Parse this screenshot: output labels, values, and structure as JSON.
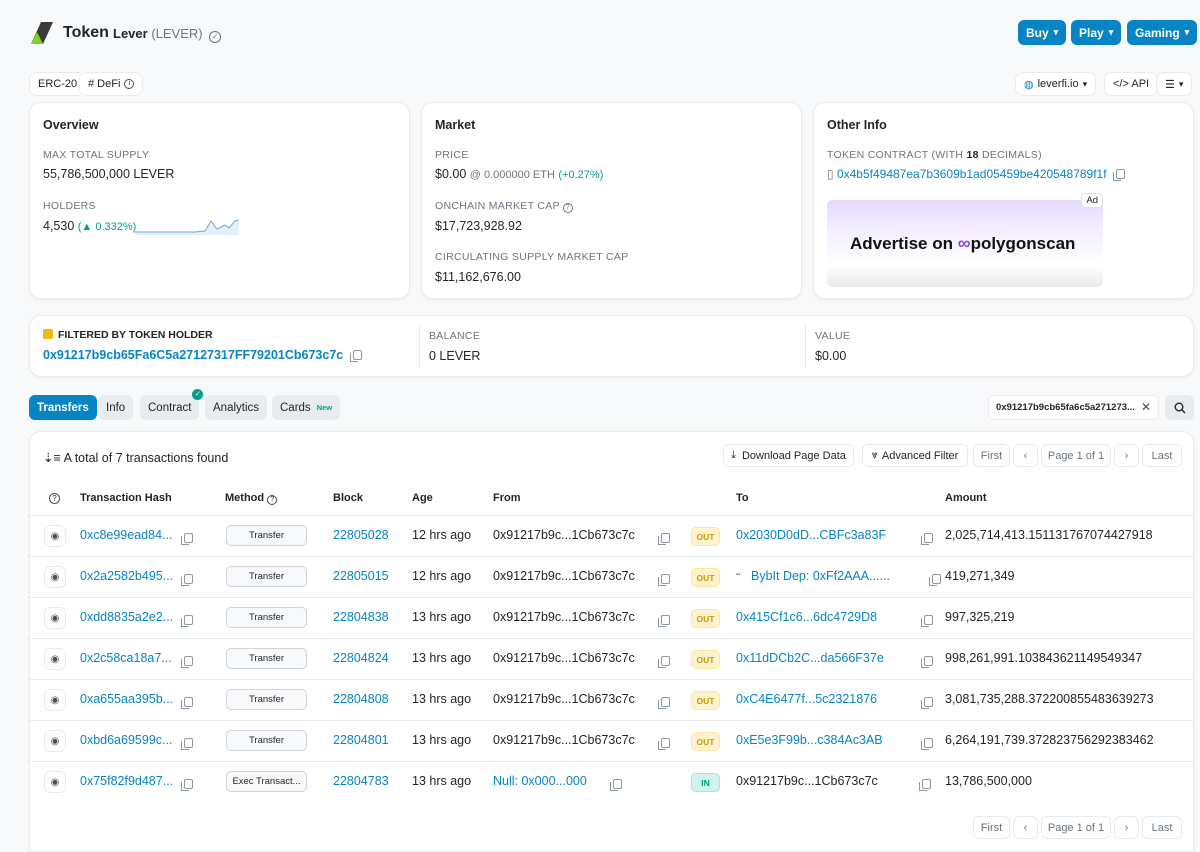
{
  "header": {
    "page_title": "Token",
    "token_name": "Lever",
    "token_symbol": "(LEVER)",
    "buttons": [
      "Buy",
      "Play",
      "Gaming"
    ]
  },
  "tags": {
    "standard": "ERC-20",
    "category": "# DeFi"
  },
  "links": {
    "website": "leverfi.io",
    "api": "</> API"
  },
  "overview": {
    "title": "Overview",
    "max_supply_label": "MAX TOTAL SUPPLY",
    "max_supply": "55,786,500,000 LEVER",
    "holders_label": "HOLDERS",
    "holders": "4,530",
    "holders_change": "(▲ 0.332%)"
  },
  "market": {
    "title": "Market",
    "price_label": "PRICE",
    "price": "$0.00",
    "price_eth": "@ 0.000000 ETH",
    "price_change": "(+0.27%)",
    "onchain_cap_label": "ONCHAIN MARKET CAP",
    "onchain_cap": "$17,723,928.92",
    "circ_cap_label": "CIRCULATING SUPPLY MARKET CAP",
    "circ_cap": "$11,162,676.00"
  },
  "other_info": {
    "title": "Other Info",
    "contract_label_prefix": "TOKEN CONTRACT (WITH",
    "decimals": "18",
    "contract_label_suffix": "DECIMALS)",
    "contract_address": "0x4b5f49487ea7b3609b1ad05459be420548789f1f",
    "ad_badge": "Ad",
    "ad_text": "Advertise on",
    "ad_brand": "polygonscan"
  },
  "filter": {
    "label": "FILTERED BY TOKEN HOLDER",
    "address": "0x91217b9cb65Fa6C5a27127317FF79201Cb673c7c",
    "balance_label": "BALANCE",
    "balance": "0 LEVER",
    "value_label": "VALUE",
    "value": "$0.00"
  },
  "tabs": [
    {
      "label": "Transfers"
    },
    {
      "label": "Info"
    },
    {
      "label": "Contract"
    },
    {
      "label": "Analytics"
    },
    {
      "label": "Cards",
      "badge": "New"
    }
  ],
  "search": {
    "value": "0x91217b9cb65fa6c5a271273..."
  },
  "table": {
    "summary": "A total of 7 transactions found",
    "download": "Download Page Data",
    "advanced_filter": "Advanced Filter",
    "pagination": {
      "first": "First",
      "page": "Page 1 of 1",
      "last": "Last"
    },
    "columns": [
      "Transaction Hash",
      "Method",
      "Block",
      "Age",
      "From",
      "To",
      "Amount"
    ],
    "rows": [
      {
        "hash": "0xc8e99ead84...",
        "method": "Transfer",
        "block": "22805028",
        "age": "12 hrs ago",
        "from": "0x91217b9c...1Cb673c7c",
        "dir": "OUT",
        "to": "0x2030D0dD...CBFc3a83F",
        "amount": "2,025,714,413.151131767074427918"
      },
      {
        "hash": "0x2a2582b495...",
        "method": "Transfer",
        "block": "22805015",
        "age": "12 hrs ago",
        "from": "0x91217b9c...1Cb673c7c",
        "dir": "OUT",
        "to": "BybIt Dep: 0xFf2AAA......",
        "amount": "419,271,349"
      },
      {
        "hash": "0xdd8835a2e2...",
        "method": "Transfer",
        "block": "22804838",
        "age": "13 hrs ago",
        "from": "0x91217b9c...1Cb673c7c",
        "dir": "OUT",
        "to": "0x415Cf1c6...6dc4729D8",
        "amount": "997,325,219"
      },
      {
        "hash": "0x2c58ca18a7...",
        "method": "Transfer",
        "block": "22804824",
        "age": "13 hrs ago",
        "from": "0x91217b9c...1Cb673c7c",
        "dir": "OUT",
        "to": "0x11dDCb2C...da566F37e",
        "amount": "998,261,991.103843621149549347"
      },
      {
        "hash": "0xa655aa395b...",
        "method": "Transfer",
        "block": "22804808",
        "age": "13 hrs ago",
        "from": "0x91217b9c...1Cb673c7c",
        "dir": "OUT",
        "to": "0xC4E6477f...5c2321876",
        "amount": "3,081,735,288.372200855483639273"
      },
      {
        "hash": "0xbd6a69599c...",
        "method": "Transfer",
        "block": "22804801",
        "age": "13 hrs ago",
        "from": "0x91217b9c...1Cb673c7c",
        "dir": "OUT",
        "to": "0xE5e3F99b...c384Ac3AB",
        "amount": "6,264,191,739.372823756292383462"
      },
      {
        "hash": "0x75f82f9d487...",
        "method": "Exec Transact...",
        "block": "22804783",
        "age": "13 hrs ago",
        "from": "Null: 0x000...000",
        "dir": "IN",
        "to": "0x91217b9c...1Cb673c7c",
        "amount": "13,786,500,000"
      }
    ]
  },
  "colors": {
    "accent": "#0784c3",
    "up": "#00a186",
    "out": "#cc9a06"
  }
}
